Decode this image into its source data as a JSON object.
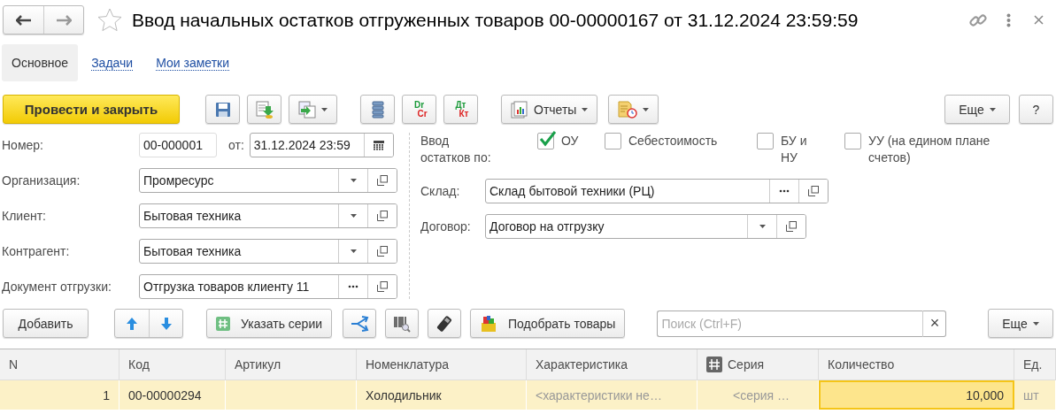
{
  "window": {
    "title": "Ввод начальных остатков отгруженных товаров 00-00000167 от 31.12.2024 23:59:59"
  },
  "tabs": [
    {
      "label": "Основное",
      "selected": true
    },
    {
      "label": "Задачи",
      "selected": false
    },
    {
      "label": "Мои заметки",
      "selected": false
    }
  ],
  "toolbar": {
    "left": [
      {
        "kind": "primary",
        "label": "Провести и закрыть"
      },
      {
        "kind": "icon"
      },
      {
        "kind": "icon"
      },
      {
        "kind": "icon-menu"
      },
      {
        "kind": "icon"
      },
      {
        "kind": "letters",
        "top": "Dr",
        "bottom": "Cr"
      },
      {
        "kind": "letters",
        "top": "Дт",
        "bottom": "Кт"
      },
      {
        "kind": "icon-menu",
        "label": "Отчеты"
      },
      {
        "kind": "icon-menu"
      }
    ],
    "right": [
      {
        "kind": "menu",
        "label": "Еще"
      },
      {
        "kind": "text",
        "label": "?"
      }
    ]
  },
  "header_fields": [
    {
      "kind": "number",
      "label": "Номер:",
      "value": "00-000001",
      "date_label": "от:",
      "date": "31.12.2024 23:59"
    },
    {
      "kind": "select",
      "label": "Организация:",
      "value": "Промресурс"
    },
    {
      "kind": "select",
      "label": "Клиент:",
      "value": "Бытовая техника"
    },
    {
      "kind": "select",
      "label": "Контрагент:",
      "value": "Бытовая техника"
    },
    {
      "kind": "choice",
      "label": "Документ отгрузки:",
      "value": "Отгрузка товаров клиенту 11"
    }
  ],
  "balances": {
    "label": "Ввод остатков по:",
    "options": [
      {
        "label": "ОУ",
        "checked": true
      },
      {
        "label": "Себестоимость",
        "checked": false
      },
      {
        "label": "БУ и НУ",
        "checked": false
      },
      {
        "label": "УУ (на едином плане счетов)",
        "checked": false
      }
    ]
  },
  "right_fields": [
    {
      "kind": "choice",
      "label": "Склад:",
      "value": "Склад бытовой техники (РЦ)"
    },
    {
      "kind": "select",
      "label": "Договор:",
      "value": "Договор на отгрузку"
    }
  ],
  "table_toolbar": {
    "buttons": [
      {
        "kind": "text",
        "label": "Добавить"
      },
      {
        "kind": "updown"
      },
      {
        "kind": "icon-text",
        "label": "Указать серии"
      },
      {
        "kind": "icon"
      },
      {
        "kind": "icon"
      },
      {
        "kind": "icon"
      },
      {
        "kind": "icon-text",
        "label": "Подобрать товары"
      }
    ],
    "search": {
      "placeholder": "Поиск (Ctrl+F)",
      "clear": "×"
    },
    "more": "Еще"
  },
  "table": {
    "columns": [
      "N",
      "Код",
      "Артикул",
      "Номенклатура",
      "Характеристика",
      "Серия",
      "Количество",
      "Ед."
    ],
    "rows": [
      {
        "selected": true,
        "cells": [
          {
            "text": "1",
            "greyed": false,
            "active": false
          },
          {
            "text": "00-00000294",
            "greyed": false,
            "active": false
          },
          {},
          {
            "text": "Холодильник",
            "greyed": false,
            "active": false
          },
          {
            "text": "<характеристики не…",
            "greyed": true,
            "active": false
          },
          {
            "text": "<серия …",
            "greyed": true,
            "active": false
          },
          {
            "text": "10,000",
            "greyed": false,
            "active": true
          },
          {
            "text": "шт",
            "greyed": true,
            "active": false
          }
        ]
      }
    ]
  }
}
